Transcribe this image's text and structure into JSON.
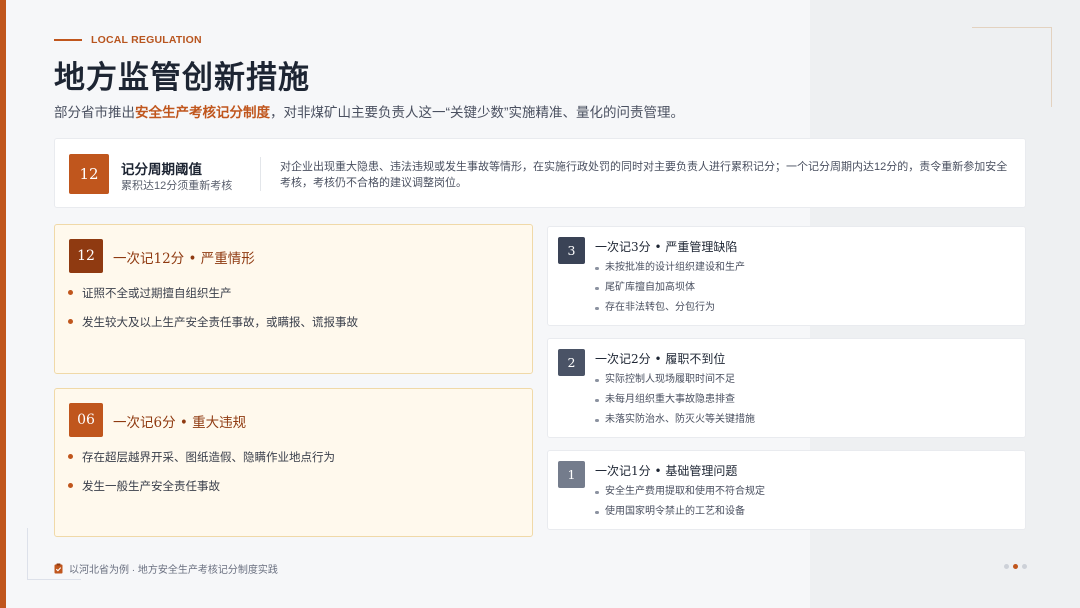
{
  "header": {
    "eyebrow": "LOCAL REGULATION",
    "title": "地方监管创新措施",
    "subtitle_pre": "部分省市推出",
    "subtitle_highlight": "安全生产考核记分制度",
    "subtitle_post": "，对非煤矿山主要负责人这一“关键少数”实施精准、量化的问责管理。"
  },
  "threshold": {
    "badge": "12",
    "title": "记分周期阈值",
    "subtitle": "累积达12分须重新考核",
    "description": "对企业出现重大隐患、违法违规或发生事故等情形，在实施行政处罚的同时对主要负责人进行累积记分；一个记分周期内达12分的，责令重新参加安全考核，考核仍不合格的建议调整岗位。"
  },
  "left_cards": [
    {
      "num": "12",
      "heading": "一次记12分  •  严重情形",
      "items": [
        "证照不全或过期擅自组织生产",
        "发生较大及以上生产安全责任事故，或瞒报、谎报事故"
      ]
    },
    {
      "num": "06",
      "heading": "一次记6分  •  重大违规",
      "items": [
        "存在超层越界开采、图纸造假、隐瞒作业地点行为",
        "发生一般生产安全责任事故"
      ]
    }
  ],
  "right_cards": [
    {
      "num": "3",
      "heading": "一次记3分  •  严重管理缺陷",
      "items": [
        "未按批准的设计组织建设和生产",
        "尾矿库擅自加高坝体",
        "存在非法转包、分包行为"
      ]
    },
    {
      "num": "2",
      "heading": "一次记2分  •  履职不到位",
      "items": [
        "实际控制人现场履职时间不足",
        "未每月组织重大事故隐患排查",
        "未落实防治水、防灭火等关键措施"
      ]
    },
    {
      "num": "1",
      "heading": "一次记1分  •  基础管理问题",
      "items": [
        "安全生产费用提取和使用不符合规定",
        "使用国家明令禁止的工艺和设备"
      ]
    }
  ],
  "footer": {
    "text": "以河北省为例 · 地方安全生产考核记分制度实践",
    "icon": "clipboard-check-icon"
  },
  "colors": {
    "accent": "#c0561d",
    "dark_accent": "#8f3a11",
    "navy": "#3a4356"
  }
}
